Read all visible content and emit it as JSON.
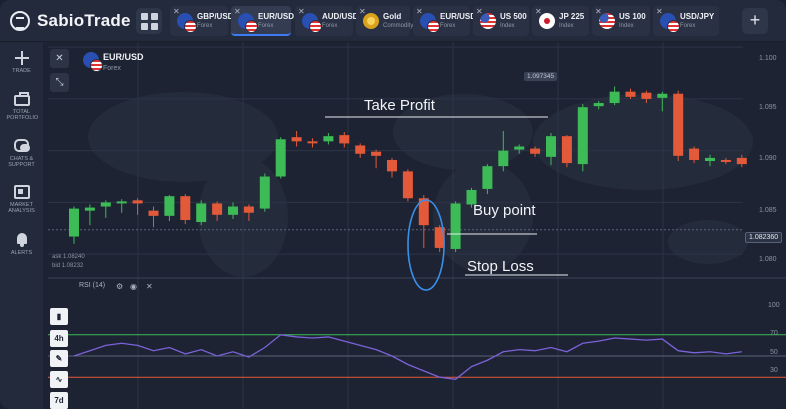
{
  "app": {
    "logo_text": "SabioTrade",
    "add_tab": "+"
  },
  "tabs": [
    {
      "name": "GBP/USD",
      "sub": "Forex",
      "flag": "flag-pair",
      "active": false
    },
    {
      "name": "EUR/USD",
      "sub": "Forex",
      "flag": "flag-pair",
      "active": true
    },
    {
      "name": "AUD/USD",
      "sub": "Forex",
      "flag": "flag-pair",
      "active": false
    },
    {
      "name": "Gold",
      "sub": "Commodity",
      "flag": "flag-gold",
      "active": false
    },
    {
      "name": "EUR/USD",
      "sub": "Forex",
      "flag": "flag-pair",
      "active": false
    },
    {
      "name": "US 500",
      "sub": "Index",
      "flag": "flag-us",
      "active": false
    },
    {
      "name": "JP 225",
      "sub": "Index",
      "flag": "flag-jp",
      "active": false
    },
    {
      "name": "US 100",
      "sub": "Index",
      "flag": "flag-us",
      "active": false
    },
    {
      "name": "USD/JPY",
      "sub": "Forex",
      "flag": "flag-pair",
      "active": false
    }
  ],
  "sidebar": [
    {
      "label": "Trade",
      "icon": "plus-icon"
    },
    {
      "label": "Total portfolio",
      "icon": "briefcase-icon"
    },
    {
      "label": "Chats & support",
      "icon": "chat-icon"
    },
    {
      "label": "Market analysis",
      "icon": "news-icon"
    },
    {
      "label": "Alerts",
      "icon": "bell-icon"
    }
  ],
  "asset": {
    "name": "EUR/USD",
    "sub": "Forex"
  },
  "tools": {
    "close": "✕",
    "collapse": "⤡"
  },
  "price_axis": [
    "1.100",
    "1.095",
    "1.090",
    "1.085",
    "1.080"
  ],
  "current_price": "1.082360",
  "high_marker": "1.097345",
  "bid_ask": {
    "ask": "ask 1.08240",
    "bid": "bid 1.08232"
  },
  "annotations": {
    "take_profit": "Take Profit",
    "buy_point": "Buy point",
    "stop_loss": "Stop Loss"
  },
  "rsi": {
    "label": "RSI (14)",
    "levels": [
      "100",
      "70",
      "50",
      "30"
    ]
  },
  "timeframes": [
    "4h",
    "7d"
  ],
  "colors": {
    "bull": "#3dbb56",
    "bear": "#e25a3a",
    "rsi_line": "#7b62d9",
    "level_70": "#3dbb56",
    "level_30": "#e25a3a",
    "accent": "#3d7cf0"
  },
  "chart_data": {
    "type": "candlestick",
    "title": "EUR/USD",
    "ylim": [
      1.0775,
      1.1005
    ],
    "candles": [
      {
        "o": 1.0817,
        "c": 1.0844,
        "h": 1.0846,
        "l": 1.081
      },
      {
        "o": 1.0842,
        "c": 1.0845,
        "h": 1.0848,
        "l": 1.0828
      },
      {
        "o": 1.0846,
        "c": 1.085,
        "h": 1.0852,
        "l": 1.0835
      },
      {
        "o": 1.0849,
        "c": 1.0851,
        "h": 1.0853,
        "l": 1.084
      },
      {
        "o": 1.0852,
        "c": 1.0849,
        "h": 1.0854,
        "l": 1.0838
      },
      {
        "o": 1.0842,
        "c": 1.0837,
        "h": 1.0846,
        "l": 1.0826
      },
      {
        "o": 1.0837,
        "c": 1.0856,
        "h": 1.0857,
        "l": 1.0832
      },
      {
        "o": 1.0856,
        "c": 1.0833,
        "h": 1.0858,
        "l": 1.0829
      },
      {
        "o": 1.0831,
        "c": 1.0849,
        "h": 1.0852,
        "l": 1.0828
      },
      {
        "o": 1.0849,
        "c": 1.0838,
        "h": 1.0851,
        "l": 1.0832
      },
      {
        "o": 1.0838,
        "c": 1.0846,
        "h": 1.085,
        "l": 1.0834
      },
      {
        "o": 1.0846,
        "c": 1.084,
        "h": 1.0848,
        "l": 1.0832
      },
      {
        "o": 1.0844,
        "c": 1.0875,
        "h": 1.0878,
        "l": 1.0841
      },
      {
        "o": 1.0875,
        "c": 1.0911,
        "h": 1.0913,
        "l": 1.0873
      },
      {
        "o": 1.0913,
        "c": 1.0909,
        "h": 1.0919,
        "l": 1.0904
      },
      {
        "o": 1.0909,
        "c": 1.0908,
        "h": 1.0912,
        "l": 1.0903
      },
      {
        "o": 1.0909,
        "c": 1.0914,
        "h": 1.0917,
        "l": 1.0906
      },
      {
        "o": 1.0915,
        "c": 1.0907,
        "h": 1.0918,
        "l": 1.0903
      },
      {
        "o": 1.0905,
        "c": 1.0897,
        "h": 1.0907,
        "l": 1.0893
      },
      {
        "o": 1.0899,
        "c": 1.0895,
        "h": 1.0901,
        "l": 1.0883
      },
      {
        "o": 1.0891,
        "c": 1.088,
        "h": 1.0893,
        "l": 1.0874
      },
      {
        "o": 1.088,
        "c": 1.0854,
        "h": 1.0882,
        "l": 1.0851
      },
      {
        "o": 1.0854,
        "c": 1.0828,
        "h": 1.0857,
        "l": 1.0806
      },
      {
        "o": 1.0826,
        "c": 1.0806,
        "h": 1.0828,
        "l": 1.0802
      },
      {
        "o": 1.0805,
        "c": 1.0849,
        "h": 1.0851,
        "l": 1.0802
      },
      {
        "o": 1.0848,
        "c": 1.0862,
        "h": 1.0864,
        "l": 1.0845
      },
      {
        "o": 1.0863,
        "c": 1.0885,
        "h": 1.0887,
        "l": 1.0858
      },
      {
        "o": 1.0885,
        "c": 1.09,
        "h": 1.0919,
        "l": 1.088
      },
      {
        "o": 1.0901,
        "c": 1.0904,
        "h": 1.0906,
        "l": 1.0897
      },
      {
        "o": 1.0902,
        "c": 1.0897,
        "h": 1.0904,
        "l": 1.0894
      },
      {
        "o": 1.0894,
        "c": 1.0914,
        "h": 1.0917,
        "l": 1.0886
      },
      {
        "o": 1.0914,
        "c": 1.0888,
        "h": 1.0915,
        "l": 1.0884
      },
      {
        "o": 1.0887,
        "c": 1.0942,
        "h": 1.0945,
        "l": 1.088
      },
      {
        "o": 1.0943,
        "c": 1.0946,
        "h": 1.0948,
        "l": 1.094
      },
      {
        "o": 1.0946,
        "c": 1.0957,
        "h": 1.0962,
        "l": 1.0944
      },
      {
        "o": 1.0957,
        "c": 1.0952,
        "h": 1.096,
        "l": 1.095
      },
      {
        "o": 1.0956,
        "c": 1.095,
        "h": 1.0958,
        "l": 1.0946
      },
      {
        "o": 1.0951,
        "c": 1.0955,
        "h": 1.0957,
        "l": 1.0938
      },
      {
        "o": 1.0955,
        "c": 1.0895,
        "h": 1.0958,
        "l": 1.089
      },
      {
        "o": 1.0902,
        "c": 1.0891,
        "h": 1.0904,
        "l": 1.0888
      },
      {
        "o": 1.089,
        "c": 1.0893,
        "h": 1.0896,
        "l": 1.0885
      },
      {
        "o": 1.0891,
        "c": 1.089,
        "h": 1.0893,
        "l": 1.0887
      },
      {
        "o": 1.0893,
        "c": 1.0887,
        "h": 1.0896,
        "l": 1.0884
      }
    ],
    "rsi_values": [
      50,
      55,
      60,
      62,
      60,
      55,
      58,
      52,
      56,
      50,
      54,
      49,
      58,
      70,
      68,
      67,
      68,
      64,
      60,
      56,
      50,
      42,
      36,
      30,
      28,
      40,
      46,
      54,
      56,
      55,
      58,
      54,
      62,
      64,
      67,
      66,
      65,
      66,
      55,
      53,
      54,
      52,
      54
    ],
    "rsi_levels": [
      70,
      50,
      30
    ]
  }
}
